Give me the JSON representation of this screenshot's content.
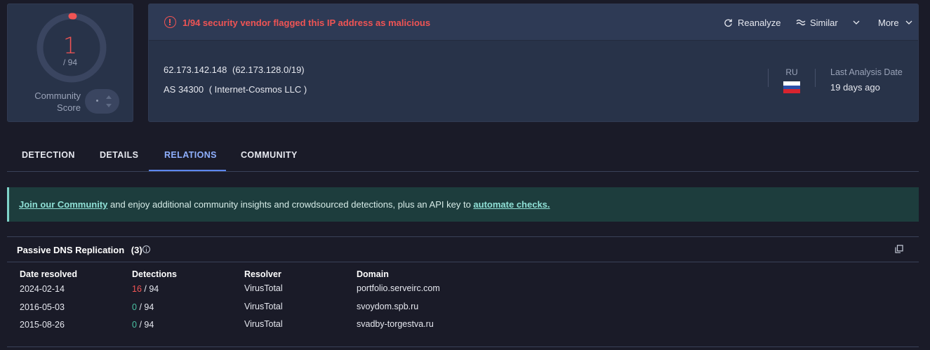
{
  "score": {
    "value": "1",
    "total": "/ 94",
    "detected_fraction": 0.0106,
    "community_label": "Community Score"
  },
  "alert": {
    "text": "1/94 security vendor flagged this IP address as malicious",
    "color": "#f05454"
  },
  "actions": {
    "reanalyze": "Reanalyze",
    "similar": "Similar",
    "more": "More"
  },
  "ip": {
    "address": "62.173.142.148",
    "network": "(62.173.128.0/19)",
    "as": "AS 34300",
    "owner": "( Internet-Cosmos LLC )"
  },
  "country": {
    "code": "RU",
    "flag_colors": [
      "#ffffff",
      "#2b4fa8",
      "#d8242f"
    ]
  },
  "last_analysis": {
    "label": "Last Analysis Date",
    "value": "19 days ago"
  },
  "tabs": [
    {
      "label": "DETECTION",
      "active": false
    },
    {
      "label": "DETAILS",
      "active": false
    },
    {
      "label": "RELATIONS",
      "active": true
    },
    {
      "label": "COMMUNITY",
      "active": false
    }
  ],
  "banner": {
    "link1": "Join our Community",
    "middle": " and enjoy additional community insights and crowdsourced detections, plus an API key to ",
    "link2": "automate checks."
  },
  "passive_dns": {
    "title": "Passive DNS Replication",
    "count": "(3)",
    "columns": [
      "Date resolved",
      "Detections",
      "Resolver",
      "Domain"
    ],
    "rows": [
      {
        "date": "2024-02-14",
        "detections": "16",
        "total": "/ 94",
        "status": "malicious",
        "resolver": "VirusTotal",
        "domain": "portfolio.serveirc.com"
      },
      {
        "date": "2016-05-03",
        "detections": "0",
        "total": "/ 94",
        "status": "clean",
        "resolver": "VirusTotal",
        "domain": "svoydom.spb.ru"
      },
      {
        "date": "2015-08-26",
        "detections": "0",
        "total": "/ 94",
        "status": "clean",
        "resolver": "VirusTotal",
        "domain": "svadby-torgestva.ru"
      }
    ]
  },
  "icons": {
    "alert": "alert-circle-icon",
    "reanalyze": "refresh-icon",
    "similar": "similar-icon",
    "chevron": "chevron-down-icon",
    "info": "info-icon",
    "copy": "copy-icon"
  }
}
